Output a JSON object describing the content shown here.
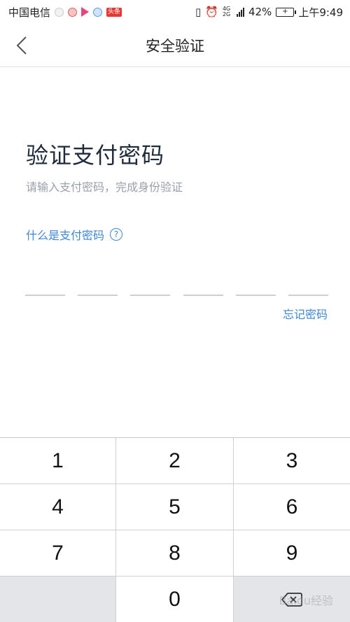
{
  "status_bar": {
    "carrier": "中国电信",
    "badge": "头条",
    "network": "4G 2G",
    "battery_percent": "42%",
    "time": "上午9:49"
  },
  "header": {
    "title": "安全验证"
  },
  "content": {
    "title": "验证支付密码",
    "subtitle": "请输入支付密码，完成身份验证",
    "help_link": "什么是支付密码",
    "pin_length": 6,
    "forgot_link": "忘记密码"
  },
  "keypad": {
    "keys": [
      "1",
      "2",
      "3",
      "4",
      "5",
      "6",
      "7",
      "8",
      "9",
      "",
      "0",
      "delete"
    ]
  },
  "watermark": "Baidu经验",
  "colors": {
    "accent": "#3e86d6",
    "title": "#1f2a3a",
    "subtitle": "#9aa0a8",
    "keypad_gray": "#e3e5e8"
  }
}
